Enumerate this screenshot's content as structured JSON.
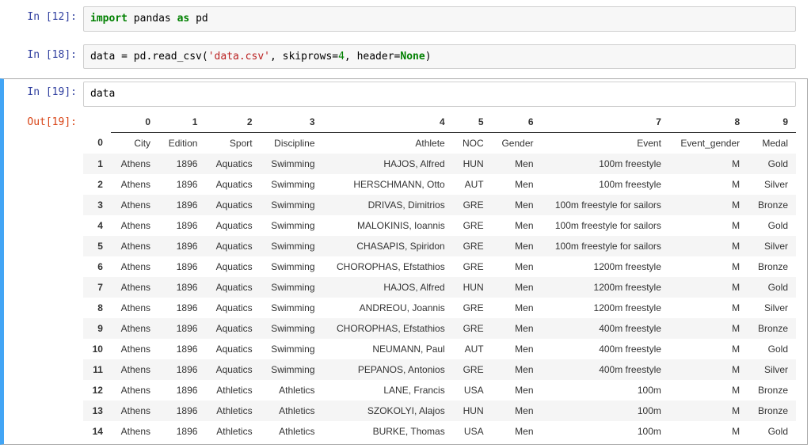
{
  "cells": {
    "c0": {
      "prompt_in": "In [12]:",
      "code_html": "<span class='tok-kw'>import</span> pandas <span class='tok-kw'>as</span> pd"
    },
    "c1": {
      "prompt_in": "In [18]:",
      "code_html": "data = pd.read_csv(<span class='tok-str'>'data.csv'</span>, skiprows=<span class='tok-num'>4</span>, header=<span class='tok-bool'>None</span>)"
    },
    "c2": {
      "prompt_in": "In [19]:",
      "prompt_out": "Out[19]:",
      "code_html": "data"
    }
  },
  "dataframe": {
    "columns": [
      "0",
      "1",
      "2",
      "3",
      "4",
      "5",
      "6",
      "7",
      "8",
      "9"
    ],
    "index": [
      "0",
      "1",
      "2",
      "3",
      "4",
      "5",
      "6",
      "7",
      "8",
      "9",
      "10",
      "11",
      "12",
      "13",
      "14"
    ],
    "rows": [
      [
        "City",
        "Edition",
        "Sport",
        "Discipline",
        "Athlete",
        "NOC",
        "Gender",
        "Event",
        "Event_gender",
        "Medal"
      ],
      [
        "Athens",
        "1896",
        "Aquatics",
        "Swimming",
        "HAJOS, Alfred",
        "HUN",
        "Men",
        "100m freestyle",
        "M",
        "Gold"
      ],
      [
        "Athens",
        "1896",
        "Aquatics",
        "Swimming",
        "HERSCHMANN, Otto",
        "AUT",
        "Men",
        "100m freestyle",
        "M",
        "Silver"
      ],
      [
        "Athens",
        "1896",
        "Aquatics",
        "Swimming",
        "DRIVAS, Dimitrios",
        "GRE",
        "Men",
        "100m freestyle for sailors",
        "M",
        "Bronze"
      ],
      [
        "Athens",
        "1896",
        "Aquatics",
        "Swimming",
        "MALOKINIS, Ioannis",
        "GRE",
        "Men",
        "100m freestyle for sailors",
        "M",
        "Gold"
      ],
      [
        "Athens",
        "1896",
        "Aquatics",
        "Swimming",
        "CHASAPIS, Spiridon",
        "GRE",
        "Men",
        "100m freestyle for sailors",
        "M",
        "Silver"
      ],
      [
        "Athens",
        "1896",
        "Aquatics",
        "Swimming",
        "CHOROPHAS, Efstathios",
        "GRE",
        "Men",
        "1200m freestyle",
        "M",
        "Bronze"
      ],
      [
        "Athens",
        "1896",
        "Aquatics",
        "Swimming",
        "HAJOS, Alfred",
        "HUN",
        "Men",
        "1200m freestyle",
        "M",
        "Gold"
      ],
      [
        "Athens",
        "1896",
        "Aquatics",
        "Swimming",
        "ANDREOU, Joannis",
        "GRE",
        "Men",
        "1200m freestyle",
        "M",
        "Silver"
      ],
      [
        "Athens",
        "1896",
        "Aquatics",
        "Swimming",
        "CHOROPHAS, Efstathios",
        "GRE",
        "Men",
        "400m freestyle",
        "M",
        "Bronze"
      ],
      [
        "Athens",
        "1896",
        "Aquatics",
        "Swimming",
        "NEUMANN, Paul",
        "AUT",
        "Men",
        "400m freestyle",
        "M",
        "Gold"
      ],
      [
        "Athens",
        "1896",
        "Aquatics",
        "Swimming",
        "PEPANOS, Antonios",
        "GRE",
        "Men",
        "400m freestyle",
        "M",
        "Silver"
      ],
      [
        "Athens",
        "1896",
        "Athletics",
        "Athletics",
        "LANE, Francis",
        "USA",
        "Men",
        "100m",
        "M",
        "Bronze"
      ],
      [
        "Athens",
        "1896",
        "Athletics",
        "Athletics",
        "SZOKOLYI, Alajos",
        "HUN",
        "Men",
        "100m",
        "M",
        "Bronze"
      ],
      [
        "Athens",
        "1896",
        "Athletics",
        "Athletics",
        "BURKE, Thomas",
        "USA",
        "Men",
        "100m",
        "M",
        "Gold"
      ]
    ]
  }
}
